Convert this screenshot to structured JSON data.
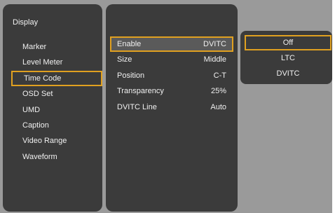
{
  "menu": {
    "title": "Display",
    "items": [
      "Marker",
      "Level Meter",
      "Time Code",
      "OSD Set",
      "UMD",
      "Caption",
      "Video Range",
      "Waveform"
    ],
    "selected": "Time Code"
  },
  "settings": {
    "rows": [
      {
        "label": "Enable",
        "value": "DVITC",
        "selected": true
      },
      {
        "label": "Size",
        "value": "Middle",
        "selected": false
      },
      {
        "label": "Position",
        "value": "C-T",
        "selected": false
      },
      {
        "label": "Transparency",
        "value": "25%",
        "selected": false
      },
      {
        "label": "DVITC Line",
        "value": "Auto",
        "selected": false
      }
    ]
  },
  "options": {
    "items": [
      "Off",
      "LTC",
      "DVITC"
    ],
    "selected": "Off"
  },
  "colors": {
    "panel": "#3b3b3b",
    "background": "#9a9a9a",
    "highlight": "#e0a020",
    "selected_row_fill": "#5a5a5a",
    "text": "#f0f0f0"
  }
}
